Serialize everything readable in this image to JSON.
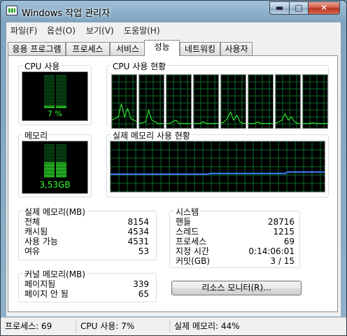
{
  "window": {
    "title": "Windows 작업 관리자",
    "min_glyph": "▬",
    "max_glyph": "□",
    "close_glyph": "✕"
  },
  "menu": [
    "파일(F)",
    "옵션(O)",
    "보기(V)",
    "도움말(H)"
  ],
  "tabs": [
    "응용 프로그램",
    "프로세스",
    "서비스",
    "성능",
    "네트워킹",
    "사용자"
  ],
  "active_tab": "성능",
  "colors": {
    "graph_green": "#33ff33",
    "grid": "#0b6b2a",
    "mem_line": "#3a7bff"
  },
  "cpu_usage": {
    "label": "CPU 사용",
    "value": "7 %",
    "fraction": 0.07
  },
  "cpu_history": {
    "label": "CPU 사용 현황",
    "core_count": 8
  },
  "memory": {
    "label": "메모리",
    "value": "3,53GB",
    "fraction": 0.44
  },
  "memory_history": {
    "label": "실제 메모리 사용 현황"
  },
  "physical_memory": {
    "label": "실제 메모리(MB)",
    "rows": [
      {
        "name": "전체",
        "value": "8154"
      },
      {
        "name": "캐시됨",
        "value": "4534"
      },
      {
        "name": "사용 가능",
        "value": "4531"
      },
      {
        "name": "여유",
        "value": "53"
      }
    ]
  },
  "system": {
    "label": "시스템",
    "rows": [
      {
        "name": "핸들",
        "value": "28716"
      },
      {
        "name": "스레드",
        "value": "1215"
      },
      {
        "name": "프로세스",
        "value": "69"
      },
      {
        "name": "지정 시간",
        "value": "0:14:06:01"
      },
      {
        "name": "커밋(GB)",
        "value": "3 / 15"
      }
    ]
  },
  "kernel_memory": {
    "label": "커널 메모리(MB)",
    "rows": [
      {
        "name": "페이지됨",
        "value": "339"
      },
      {
        "name": "페이지 안 됨",
        "value": "65"
      }
    ]
  },
  "resource_monitor_button": "리소스 모니터(R)...",
  "status": {
    "processes": "프로세스: 69",
    "cpu": "CPU 사용: 7%",
    "memory": "실제 메모리: 44%"
  }
}
